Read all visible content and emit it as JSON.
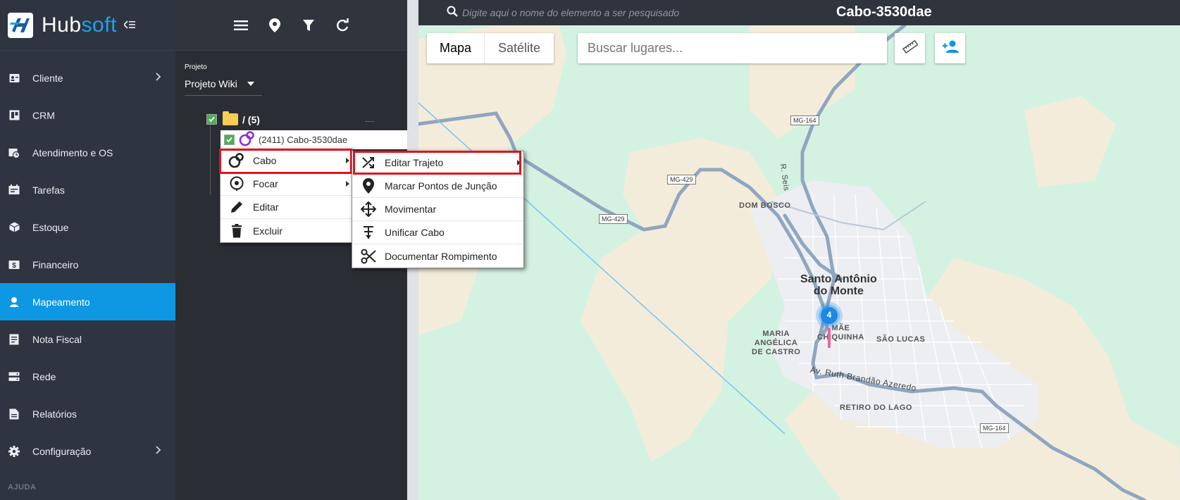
{
  "brand": {
    "part1": "Hub",
    "part2": "soft"
  },
  "nav": {
    "items": [
      {
        "label": "Cliente",
        "icon": "person-card-icon",
        "has_submenu": true,
        "active": false
      },
      {
        "label": "CRM",
        "icon": "board-icon",
        "has_submenu": false,
        "active": false
      },
      {
        "label": "Atendimento e OS",
        "icon": "calendar-clock-icon",
        "has_submenu": false,
        "active": false
      },
      {
        "label": "Tarefas",
        "icon": "task-board-icon",
        "has_submenu": false,
        "active": false
      },
      {
        "label": "Estoque",
        "icon": "box-icon",
        "has_submenu": false,
        "active": false
      },
      {
        "label": "Financeiro",
        "icon": "money-icon",
        "has_submenu": false,
        "active": false
      },
      {
        "label": "Mapeamento",
        "icon": "map-pin-person-icon",
        "has_submenu": false,
        "active": true
      },
      {
        "label": "Nota Fiscal",
        "icon": "invoice-icon",
        "has_submenu": false,
        "active": false
      },
      {
        "label": "Rede",
        "icon": "server-icon",
        "has_submenu": false,
        "active": false
      },
      {
        "label": "Relatórios",
        "icon": "report-icon",
        "has_submenu": false,
        "active": false
      },
      {
        "label": "Configuração",
        "icon": "gear-icon",
        "has_submenu": true,
        "active": false
      }
    ],
    "section_label": "AJUDA"
  },
  "panel": {
    "project_label": "Projeto",
    "project_value": "Projeto Wiki",
    "tree_root": "/ (5)",
    "tree_node": "(2411) Cabo-3530dae"
  },
  "topbar": {
    "search_placeholder": "Digite aqui o nome do elemento a ser pesquisado",
    "title": "Cabo-3530dae"
  },
  "map": {
    "type_selected": "Mapa",
    "type_other": "Satélite",
    "places_placeholder": "Buscar lugares...",
    "cluster_count": "4",
    "city": "Santo Antônio do Monte",
    "city_line1": "Santo Antônio",
    "city_line2": "do Monte",
    "labels": {
      "dom_bosco": "DOM BOSCO",
      "maria_line1": "MARIA",
      "maria_line2": "ANGÉLICA",
      "maria_line3": "DE CASTRO",
      "mae_line1": "MÃE",
      "mae_line2": "CHIQUINHA",
      "sao_lucas": "SÃO LUCAS",
      "retiro": "RETIRO DO LAGO",
      "avenue": "Av. Ruth Brandão Azeredo",
      "rseis": "R. Seis"
    },
    "roads": {
      "mg164": "MG-164",
      "mg429": "MG-429"
    }
  },
  "context_menu": {
    "items": [
      {
        "label": "Cabo",
        "icon": "cable-icon",
        "submenu": true
      },
      {
        "label": "Focar",
        "icon": "target-pin-icon",
        "submenu": true
      },
      {
        "label": "Editar",
        "icon": "pencil-icon",
        "submenu": false
      },
      {
        "label": "Excluir",
        "icon": "trash-icon",
        "submenu": false
      }
    ]
  },
  "submenu": {
    "items": [
      {
        "label": "Editar Trajeto",
        "icon": "shuffle-icon",
        "submenu": true
      },
      {
        "label": "Marcar Pontos de Junção",
        "icon": "pin-icon",
        "submenu": false
      },
      {
        "label": "Movimentar",
        "icon": "move-arrows-icon",
        "submenu": false
      },
      {
        "label": "Unificar Cabo",
        "icon": "merge-icon",
        "submenu": false
      },
      {
        "label": "Documentar Rompimento",
        "icon": "scissors-icon",
        "submenu": false
      }
    ]
  },
  "colors": {
    "nav_bg": "#2f3540",
    "active": "#0e98e3",
    "brand_accent": "#1aa3ec",
    "highlight": "#e0141e",
    "map_green": "#d4f2e2"
  }
}
